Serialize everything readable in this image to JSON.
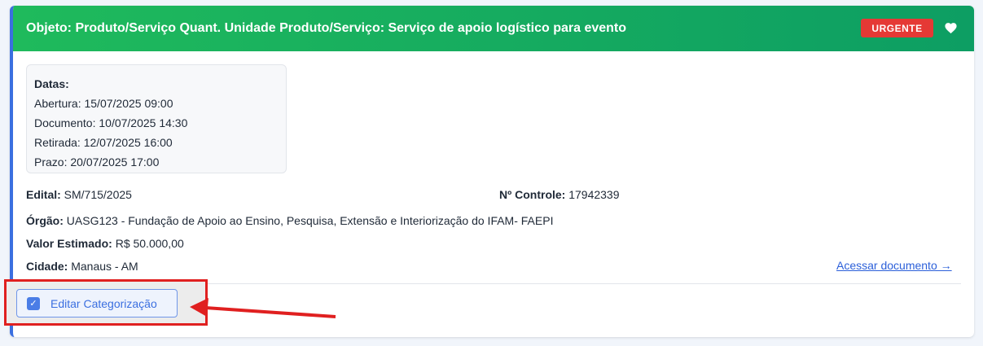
{
  "header": {
    "title": "Objeto: Produto/Serviço Quant. Unidade Produto/Serviço: Serviço de apoio logístico para evento",
    "badge": "URGENTE"
  },
  "dates": {
    "title": "Datas:",
    "abertura_label": "Abertura:",
    "abertura_value": "15/07/2025 09:00",
    "documento_label": "Documento:",
    "documento_value": "10/07/2025 14:30",
    "retirada_label": "Retirada:",
    "retirada_value": "12/07/2025 16:00",
    "prazo_label": "Prazo:",
    "prazo_value": "20/07/2025 17:00"
  },
  "details": {
    "edital_label": "Edital:",
    "edital_value": "SM/715/2025",
    "controle_label": "Nº Controle:",
    "controle_value": "17942339",
    "orgao_label": "Órgão:",
    "orgao_value": "UASG123 - Fundação de Apoio ao Ensino, Pesquisa, Extensão e Interiorização do IFAM- FAEPI",
    "valor_label": "Valor Estimado:",
    "valor_value": "R$ 50.000,00",
    "cidade_label": "Cidade:",
    "cidade_value": "Manaus - AM"
  },
  "actions": {
    "access_link": "Acessar documento →",
    "edit_button": "Editar Categorização"
  },
  "colors": {
    "header_start": "#1fba5c",
    "header_end": "#0d9e63",
    "badge": "#e53935",
    "accent": "#3b6fe0",
    "annotation": "#e02020"
  },
  "icons": {
    "favorite": "heart-icon",
    "edit": "checkbox-icon",
    "annotation": "arrow-annotation"
  }
}
